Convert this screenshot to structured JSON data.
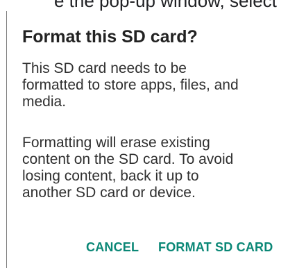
{
  "background_text": "e the pop-up window, select",
  "dialog": {
    "title": "Format this SD card?",
    "message_paragraph_1": "This SD card needs to be\nformatted to store apps, files, and\nmedia.",
    "message_paragraph_2": "Formatting will erase existing\ncontent on the SD card. To avoid\nlosing content, back it up to\nanother SD card or device.",
    "buttons": {
      "cancel_label": "CANCEL",
      "format_label": "FORMAT SD CARD"
    }
  },
  "colors": {
    "accent": "#0a8776",
    "title_text": "#222222",
    "body_text": "#303030",
    "dialog_border": "#7d7d7d"
  }
}
